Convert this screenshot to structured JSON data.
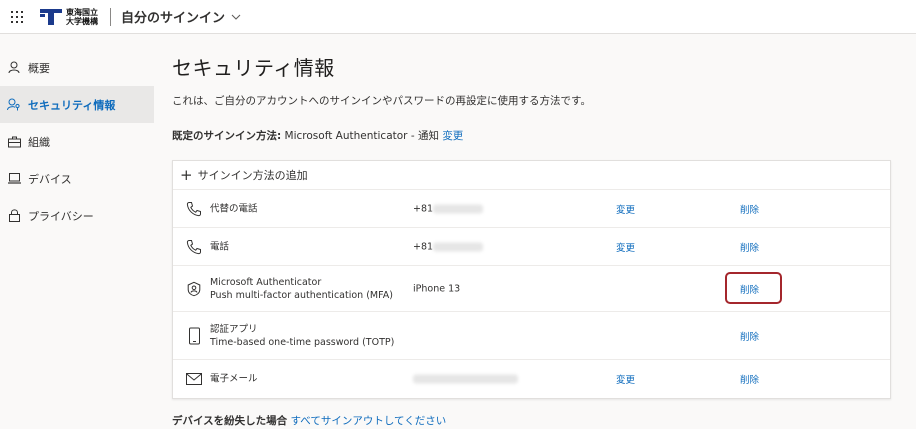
{
  "header": {
    "org_line1": "東海国立",
    "org_line2": "大学機構",
    "app_title": "自分のサインイン",
    "logo_color": "#1b3a8c"
  },
  "sidebar": {
    "items": [
      {
        "label": "概要",
        "icon": "person-icon",
        "active": false
      },
      {
        "label": "セキュリティ情報",
        "icon": "person-key-icon",
        "active": true
      },
      {
        "label": "組織",
        "icon": "briefcase-icon",
        "active": false
      },
      {
        "label": "デバイス",
        "icon": "laptop-icon",
        "active": false
      },
      {
        "label": "プライバシー",
        "icon": "lock-icon",
        "active": false
      }
    ]
  },
  "main": {
    "title": "セキュリティ情報",
    "subtitle": "これは、ご自分のアカウントへのサインインやパスワードの再設定に使用する方法です。",
    "default_label": "既定のサインイン方法:",
    "default_value": "Microsoft Authenticator - 通知",
    "default_change": "変更",
    "add_method": "サインイン方法の追加",
    "methods": [
      {
        "icon": "phone-icon",
        "name": "代替の電話",
        "desc": "",
        "detail": "+81",
        "change": "変更",
        "delete": "削除"
      },
      {
        "icon": "phone-icon",
        "name": "電話",
        "desc": "",
        "detail": "+81",
        "change": "変更",
        "delete": "削除"
      },
      {
        "icon": "authenticator-icon",
        "name": "Microsoft Authenticator",
        "desc": "Push multi-factor authentication (MFA)",
        "detail": "iPhone 13",
        "change": "",
        "delete": "削除"
      },
      {
        "icon": "mobile-device-icon",
        "name": "認証アプリ",
        "desc": "Time-based one-time password (TOTP)",
        "detail": "",
        "change": "",
        "delete": "削除"
      },
      {
        "icon": "mail-icon",
        "name": "電子メール",
        "desc": "",
        "detail": "",
        "change": "変更",
        "delete": "削除"
      }
    ],
    "lost_label": "デバイスを紛失した場合",
    "lost_link": "すべてサインアウトしてください"
  },
  "colors": {
    "accent": "#0f6cbd",
    "highlight": "#a4262c"
  }
}
